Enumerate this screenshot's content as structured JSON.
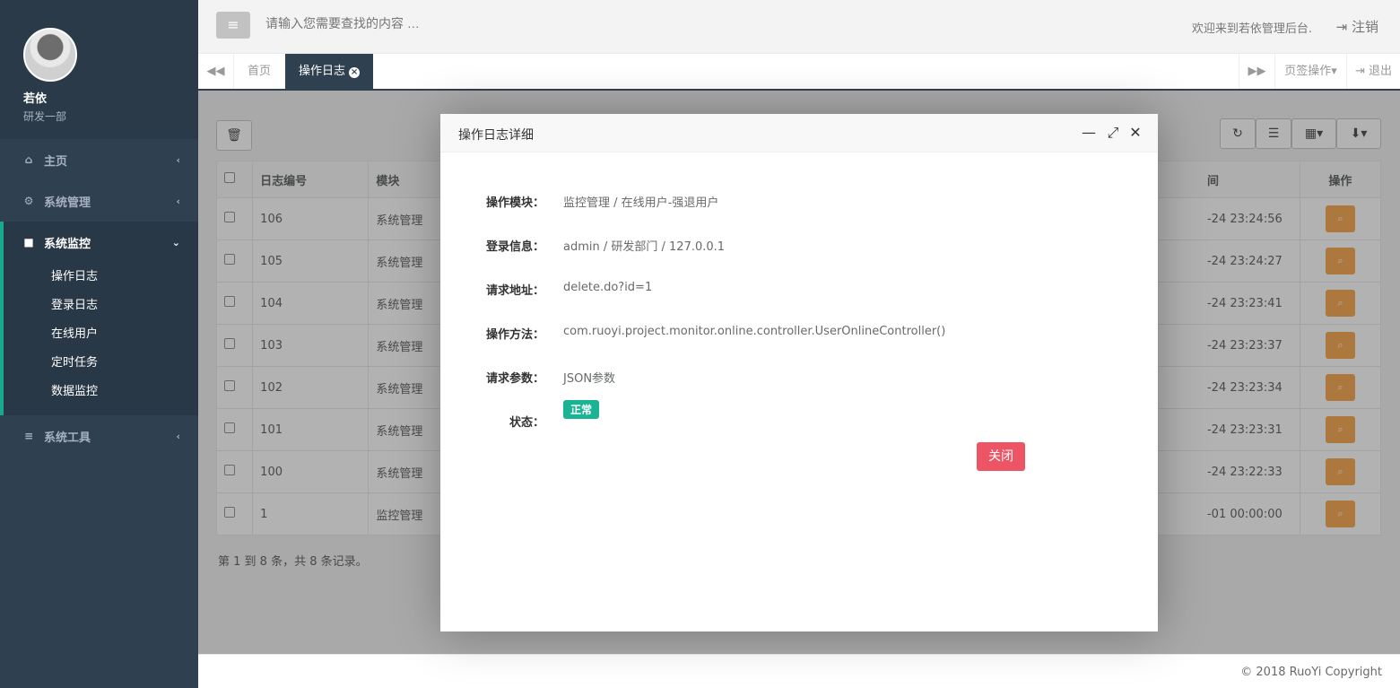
{
  "profile": {
    "name": "若依",
    "dept": "研发一部"
  },
  "sidebar": {
    "items": [
      {
        "label": "主页",
        "icon": "home-icon"
      },
      {
        "label": "系统管理",
        "icon": "gear-icon"
      },
      {
        "label": "系统监控",
        "icon": "video-camera-icon",
        "active": true,
        "children": [
          "操作日志",
          "登录日志",
          "在线用户",
          "定时任务",
          "数据监控"
        ]
      },
      {
        "label": "系统工具",
        "icon": "bars-icon"
      }
    ]
  },
  "header": {
    "search_placeholder": "请输入您需要查找的内容 …",
    "welcome": "欢迎来到若依管理后台.",
    "logout": "注销"
  },
  "tabs": {
    "items": [
      "首页",
      "操作日志"
    ],
    "page_ops": "页签操作",
    "exit": "退出"
  },
  "table": {
    "headers": [
      "日志编号",
      "模块",
      "间",
      "操作"
    ],
    "rows": [
      {
        "id": "106",
        "module": "系统管理",
        "time": "-24 23:24:56"
      },
      {
        "id": "105",
        "module": "系统管理",
        "time": "-24 23:24:27"
      },
      {
        "id": "104",
        "module": "系统管理",
        "time": "-24 23:23:41"
      },
      {
        "id": "103",
        "module": "系统管理",
        "time": "-24 23:23:37"
      },
      {
        "id": "102",
        "module": "系统管理",
        "time": "-24 23:23:34"
      },
      {
        "id": "101",
        "module": "系统管理",
        "time": "-24 23:23:31"
      },
      {
        "id": "100",
        "module": "系统管理",
        "time": "-24 23:22:33"
      },
      {
        "id": "1",
        "module": "监控管理",
        "time": "-01 00:00:00"
      }
    ],
    "page_info": "第 1 到 8 条，共 8 条记录。"
  },
  "modal": {
    "title": "操作日志详细",
    "fields": [
      {
        "label": "操作模块：",
        "value": "监控管理 / 在线用户-强退用户"
      },
      {
        "label": "登录信息：",
        "value": "admin / 研发部门 / 127.0.0.1"
      },
      {
        "label": "请求地址：",
        "value": "delete.do?id=1"
      },
      {
        "label": "操作方法：",
        "value": "com.ruoyi.project.monitor.online.controller.UserOnlineController()"
      },
      {
        "label": "请求参数：",
        "value": "JSON参数"
      },
      {
        "label": "状态：",
        "value": "正常"
      }
    ],
    "close_label": "关闭"
  },
  "footer": {
    "copyright": "© 2018 RuoYi Copyright"
  },
  "colors": {
    "sidebar": "#2f4050",
    "accent": "#1ab394",
    "warning": "#f8ac59",
    "danger": "#ed5565"
  }
}
